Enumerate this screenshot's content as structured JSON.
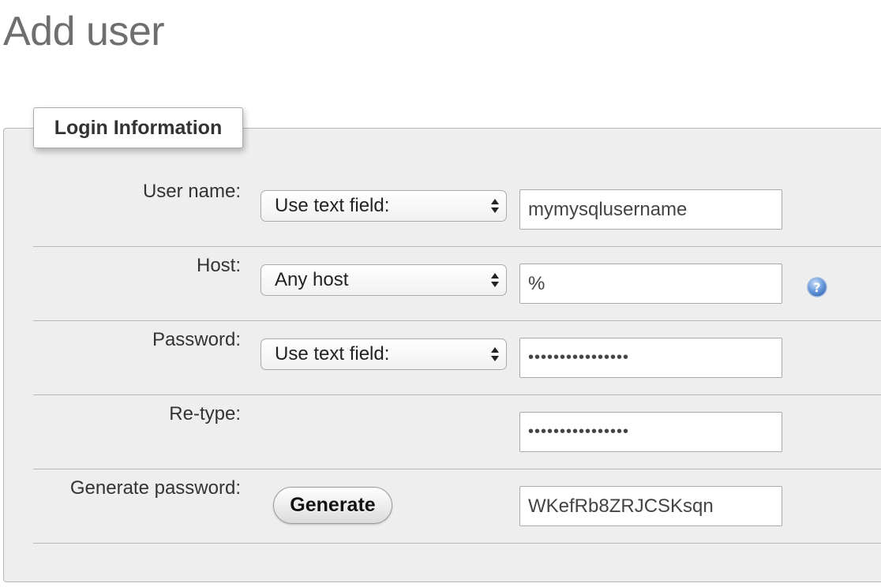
{
  "page": {
    "title": "Add user"
  },
  "fieldset": {
    "legend": "Login Information",
    "rows": {
      "username": {
        "label": "User name:",
        "select": "Use text field:",
        "value": "mymysqlusername"
      },
      "host": {
        "label": "Host:",
        "select": "Any host",
        "value": "%",
        "help_icon": "question-circle-icon"
      },
      "password": {
        "label": "Password:",
        "select": "Use text field:",
        "value": "••••••••••••••••"
      },
      "retype": {
        "label": "Re-type:",
        "value": "••••••••••••••••"
      },
      "generate": {
        "label": "Generate password:",
        "button": "Generate",
        "value": "WKefRb8ZRJCSKsqn"
      }
    }
  },
  "colors": {
    "help_icon": "#5a8fd6",
    "panel_bg": "#eeeeee"
  }
}
